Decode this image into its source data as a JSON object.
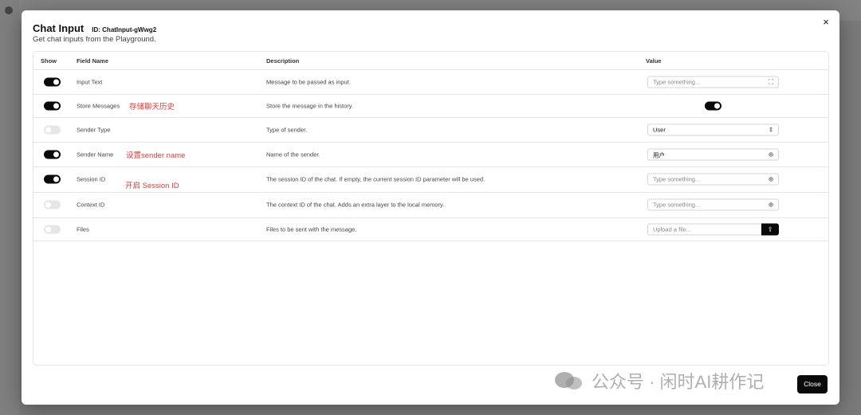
{
  "modal": {
    "title": "Chat Input",
    "node_id": "ID: ChatInput-gWwg2",
    "subtitle": "Get chat inputs from the Playground.",
    "close_icon": "×",
    "close_label": "Close"
  },
  "table": {
    "headers": [
      "Show",
      "Field Name",
      "Description",
      "Value"
    ],
    "rows": [
      {
        "show": true,
        "field": "Input Text",
        "description": "Message to be passed as input.",
        "value": "",
        "placeholder": "Type something...",
        "value_type": "text-expand",
        "annotation": ""
      },
      {
        "show": true,
        "field": "Store Messages",
        "description": "Store the message in the history.",
        "value": true,
        "placeholder": "",
        "value_type": "toggle",
        "annotation": "存储聊天历史"
      },
      {
        "show": false,
        "field": "Sender Type",
        "description": "Type of sender.",
        "value": "User",
        "placeholder": "",
        "value_type": "select",
        "annotation": ""
      },
      {
        "show": true,
        "field": "Sender Name",
        "description": "Name of the sender.",
        "value": "用户",
        "placeholder": "",
        "value_type": "text-globe",
        "annotation": "设置sender name"
      },
      {
        "show": true,
        "field": "Session ID",
        "description": "The session ID of the chat. If empty, the current session ID parameter will be used.",
        "value": "",
        "placeholder": "Type something...",
        "value_type": "text-globe",
        "annotation": "开启 Session ID"
      },
      {
        "show": false,
        "field": "Context ID",
        "description": "The context ID of the chat. Adds an extra layer to the local memory.",
        "value": "",
        "placeholder": "Type something...",
        "value_type": "text-globe",
        "annotation": ""
      },
      {
        "show": false,
        "field": "Files",
        "description": "Files to be sent with the message.",
        "value": "",
        "placeholder": "Upload a file...",
        "value_type": "file",
        "annotation": ""
      }
    ]
  },
  "icons": {
    "expand": "expand-icon",
    "globe": "globe-icon",
    "chevron": "chevron-up-down-icon",
    "upload": "upload-icon"
  },
  "watermark": {
    "text": "公众号 · 闲时AI耕作记"
  },
  "colors": {
    "accent": "#0a0a0a",
    "annotation": "#e53935"
  }
}
